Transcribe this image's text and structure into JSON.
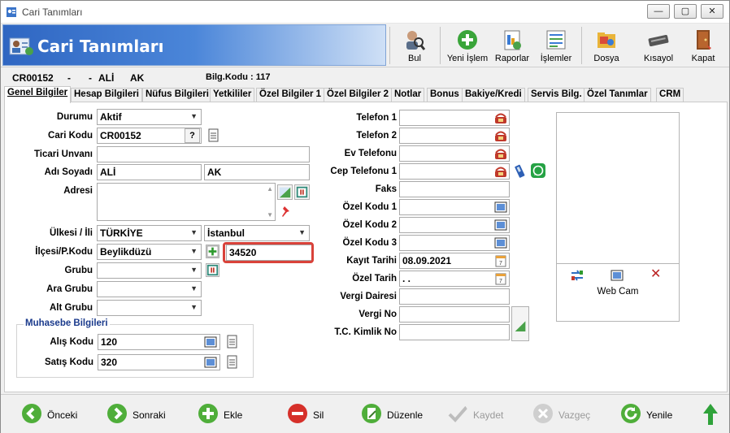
{
  "window": {
    "title": "Cari Tanımları",
    "min": "—",
    "max": "▢",
    "close": "✕"
  },
  "banner": {
    "title": "Cari Tanımları"
  },
  "toolbar": {
    "bul": "Bul",
    "yeni": "Yeni İşlem",
    "raporlar": "Raporlar",
    "islemler": "İşlemler",
    "dosya": "Dosya",
    "kisayol": "Kısayol",
    "kapat": "Kapat"
  },
  "idrow": {
    "code": "CR00152",
    "dash1": "-",
    "dash2": "-",
    "first": "ALİ",
    "last": "AK",
    "bilg": "Bilg.Kodu : 117"
  },
  "tabs": [
    "Genel Bilgiler",
    "Hesap Bilgileri",
    "Nüfus Bilgileri",
    "Yetkililer",
    "Özel Bilgiler 1",
    "Özel Bilgiler 2",
    "Notlar",
    "Bonus",
    "Bakiye/Kredi",
    "Servis Bilg.",
    "Özel Tanımlar",
    "CRM"
  ],
  "left": {
    "durum_l": "Durumu",
    "durum_v": "Aktif",
    "cari_l": "Cari Kodu",
    "cari_v": "CR00152",
    "q": "?",
    "ticari_l": "Ticari Unvanı",
    "ticari_v": "",
    "ad_l": "Adı Soyadı",
    "ad_v": "ALİ",
    "soyad_v": "AK",
    "adres_l": "Adresi",
    "ulke_l": "Ülkesi / İli",
    "ulke_v": "TÜRKİYE",
    "il_v": "İstanbul",
    "ilce_l": "İlçesi/P.Kodu",
    "ilce_v": "Beylikdüzü",
    "pk_v": "34520",
    "grup_l": "Grubu",
    "ara_l": "Ara Grubu",
    "alt_l": "Alt Grubu",
    "muh_l": "Muhasebe Bilgileri",
    "alis_l": "Alış Kodu",
    "alis_v": "120",
    "satis_l": "Satış Kodu",
    "satis_v": "320"
  },
  "mid": {
    "tel1": "Telefon 1",
    "tel2": "Telefon 2",
    "ev": "Ev Telefonu",
    "cep": "Cep Telefonu 1",
    "faks": "Faks",
    "oz1": "Özel Kodu 1",
    "oz2": "Özel Kodu 2",
    "oz3": "Özel Kodu 3",
    "kayit_l": "Kayıt Tarihi",
    "kayit_v": "08.09.2021",
    "oztar_l": "Özel Tarih",
    "oztar_v": " . .",
    "vd": "Vergi Dairesi",
    "vn": "Vergi No",
    "tc": "T.C. Kimlik No"
  },
  "cam": {
    "label": "Web Cam",
    "cal": "7"
  },
  "nav": {
    "onceki": "Önceki",
    "sonraki": "Sonraki",
    "ekle": "Ekle",
    "sil": "Sil",
    "duzenle": "Düzenle",
    "kaydet": "Kaydet",
    "vazgec": "Vazgeç",
    "yenile": "Yenile"
  }
}
